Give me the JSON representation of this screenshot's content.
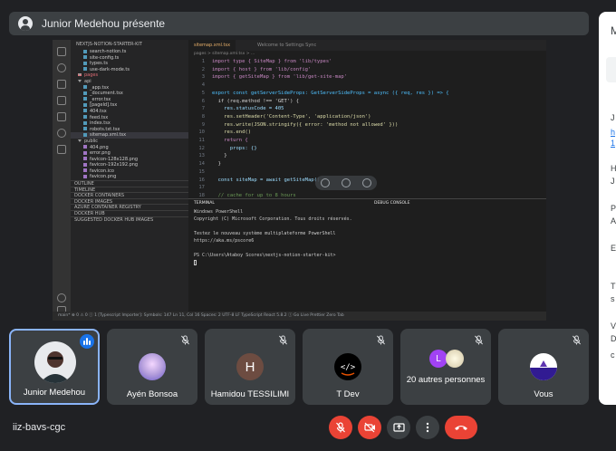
{
  "presenter": {
    "text": "Junior Medehou présente"
  },
  "shared_screen": {
    "editor_tabs": [
      "sitemap.xml.tsx",
      "Welcome to Settings Sync"
    ],
    "breadcrumb": "pages > sitemap.xml.tsx > ...",
    "explorer_header": "NEXTJS-NOTION-STARTER-KIT",
    "files": [
      {
        "name": "search-notion.ts",
        "kind": "file"
      },
      {
        "name": "site-config.ts",
        "kind": "file"
      },
      {
        "name": "types.ts",
        "kind": "file"
      },
      {
        "name": "use-dark-mode.ts",
        "kind": "file"
      },
      {
        "name": "pages",
        "kind": "folder-red"
      },
      {
        "name": "api",
        "kind": "folder"
      },
      {
        "name": "_app.tsx",
        "kind": "file"
      },
      {
        "name": "_document.tsx",
        "kind": "file"
      },
      {
        "name": "_error.tsx",
        "kind": "file"
      },
      {
        "name": "[pageId].tsx",
        "kind": "file"
      },
      {
        "name": "404.tsx",
        "kind": "file"
      },
      {
        "name": "feed.tsx",
        "kind": "file"
      },
      {
        "name": "index.tsx",
        "kind": "file"
      },
      {
        "name": "robots.txt.tsx",
        "kind": "file"
      },
      {
        "name": "sitemap.xml.tsx",
        "kind": "selected"
      },
      {
        "name": "public",
        "kind": "folder"
      },
      {
        "name": "404.png",
        "kind": "png"
      },
      {
        "name": "error.png",
        "kind": "png"
      },
      {
        "name": "favicon-128x128.png",
        "kind": "png"
      },
      {
        "name": "favicon-192x192.png",
        "kind": "png"
      },
      {
        "name": "favicon.ico",
        "kind": "png"
      },
      {
        "name": "favicon.png",
        "kind": "png"
      },
      {
        "name": "OUTLINE",
        "kind": "section"
      },
      {
        "name": "TIMELINE",
        "kind": "section"
      },
      {
        "name": "DOCKER CONTAINERS",
        "kind": "section"
      },
      {
        "name": "DOCKER IMAGES",
        "kind": "section"
      },
      {
        "name": "AZURE CONTAINER REGISTRY",
        "kind": "section"
      },
      {
        "name": "DOCKER HUB",
        "kind": "section"
      },
      {
        "name": "SUGGESTED DOCKER HUB IMAGES",
        "kind": "section"
      }
    ],
    "code_lines": [
      {
        "n": "1",
        "text": "import type { SiteMap } from 'lib/types'",
        "color": "#c586c0"
      },
      {
        "n": "2",
        "text": "import { host } from 'lib/config'",
        "color": "#c586c0"
      },
      {
        "n": "3",
        "text": "import { getSiteMap } from 'lib/get-site-map'",
        "color": "#c586c0"
      },
      {
        "n": "4",
        "text": "",
        "color": "#d4d4d4"
      },
      {
        "n": "5",
        "text": "export const getServerSideProps: GetServerSideProps = async ({ req, res }) => {",
        "color": "#4fc1ff"
      },
      {
        "n": "6",
        "text": "  if (req.method !== 'GET') {",
        "color": "#d4d4d4"
      },
      {
        "n": "7",
        "text": "    res.statusCode = 405",
        "color": "#9cdcfe"
      },
      {
        "n": "8",
        "text": "    res.setHeader('Content-Type', 'application/json')",
        "color": "#dcdcaa"
      },
      {
        "n": "9",
        "text": "    res.write(JSON.stringify({ error: 'method not allowed' }))",
        "color": "#dcdcaa"
      },
      {
        "n": "10",
        "text": "    res.end()",
        "color": "#dcdcaa"
      },
      {
        "n": "11",
        "text": "    return {",
        "color": "#c586c0"
      },
      {
        "n": "12",
        "text": "      props: {}",
        "color": "#9cdcfe"
      },
      {
        "n": "13",
        "text": "    }",
        "color": "#d4d4d4"
      },
      {
        "n": "14",
        "text": "  }",
        "color": "#d4d4d4"
      },
      {
        "n": "15",
        "text": "",
        "color": "#d4d4d4"
      },
      {
        "n": "16",
        "text": "  const siteMap = await getSiteMap()",
        "color": "#9cdcfe"
      },
      {
        "n": "17",
        "text": "",
        "color": "#d4d4d4"
      },
      {
        "n": "18",
        "text": "  // cache for up to 8 hours",
        "color": "#6a9955"
      }
    ],
    "terminal_tabs": [
      "TERMINAL",
      "DEBUG CONSOLE"
    ],
    "terminal_lines": [
      "Windows PowerShell",
      "Copyright (C) Microsoft Corporation. Tous droits réservés.",
      "",
      "Testez le nouveau système multiplateforme PowerShell",
      "https://aka.ms/pscore6",
      "",
      "PS C:\\Users\\Ataboy Scores\\nextjs-notion-starter-kit>"
    ],
    "status_bar": "main*  ⊗ 0 ⚠ 0   ⓘ 1   [Typescript Importer]: Symbols: 147     Ln 11, Col 16   Spaces: 2   UTF-8   LF   TypeScript React   5.8.2   ⓘ Go Live   Prettier   Zero Tab"
  },
  "side_panel_letters": [
    "M",
    "J",
    "h",
    "1",
    "H",
    "J",
    "P",
    "A",
    "E",
    "T",
    "s",
    "V",
    "D",
    "c"
  ],
  "tiles": [
    {
      "name": "Junior Medehou",
      "speaking": true
    },
    {
      "name": "Ayén Bonsoa",
      "muted": true
    },
    {
      "name": "Hamidou TESSILIMI",
      "muted": true,
      "initial": "H"
    },
    {
      "name": "T Dev",
      "muted": true
    },
    {
      "name": "20 autres personnes",
      "muted": true,
      "initial": "L"
    },
    {
      "name": "Vous",
      "muted": true
    }
  ],
  "meeting": {
    "code": "iiz-bavs-cgc"
  },
  "colors": {
    "background": "#202124",
    "tile": "#3c4043",
    "danger": "#ea4335",
    "accent": "#8ab4f8",
    "speaking": "#1a73e8",
    "avatar_h": "#6d4c41",
    "avatar_l": "#a142f4"
  }
}
